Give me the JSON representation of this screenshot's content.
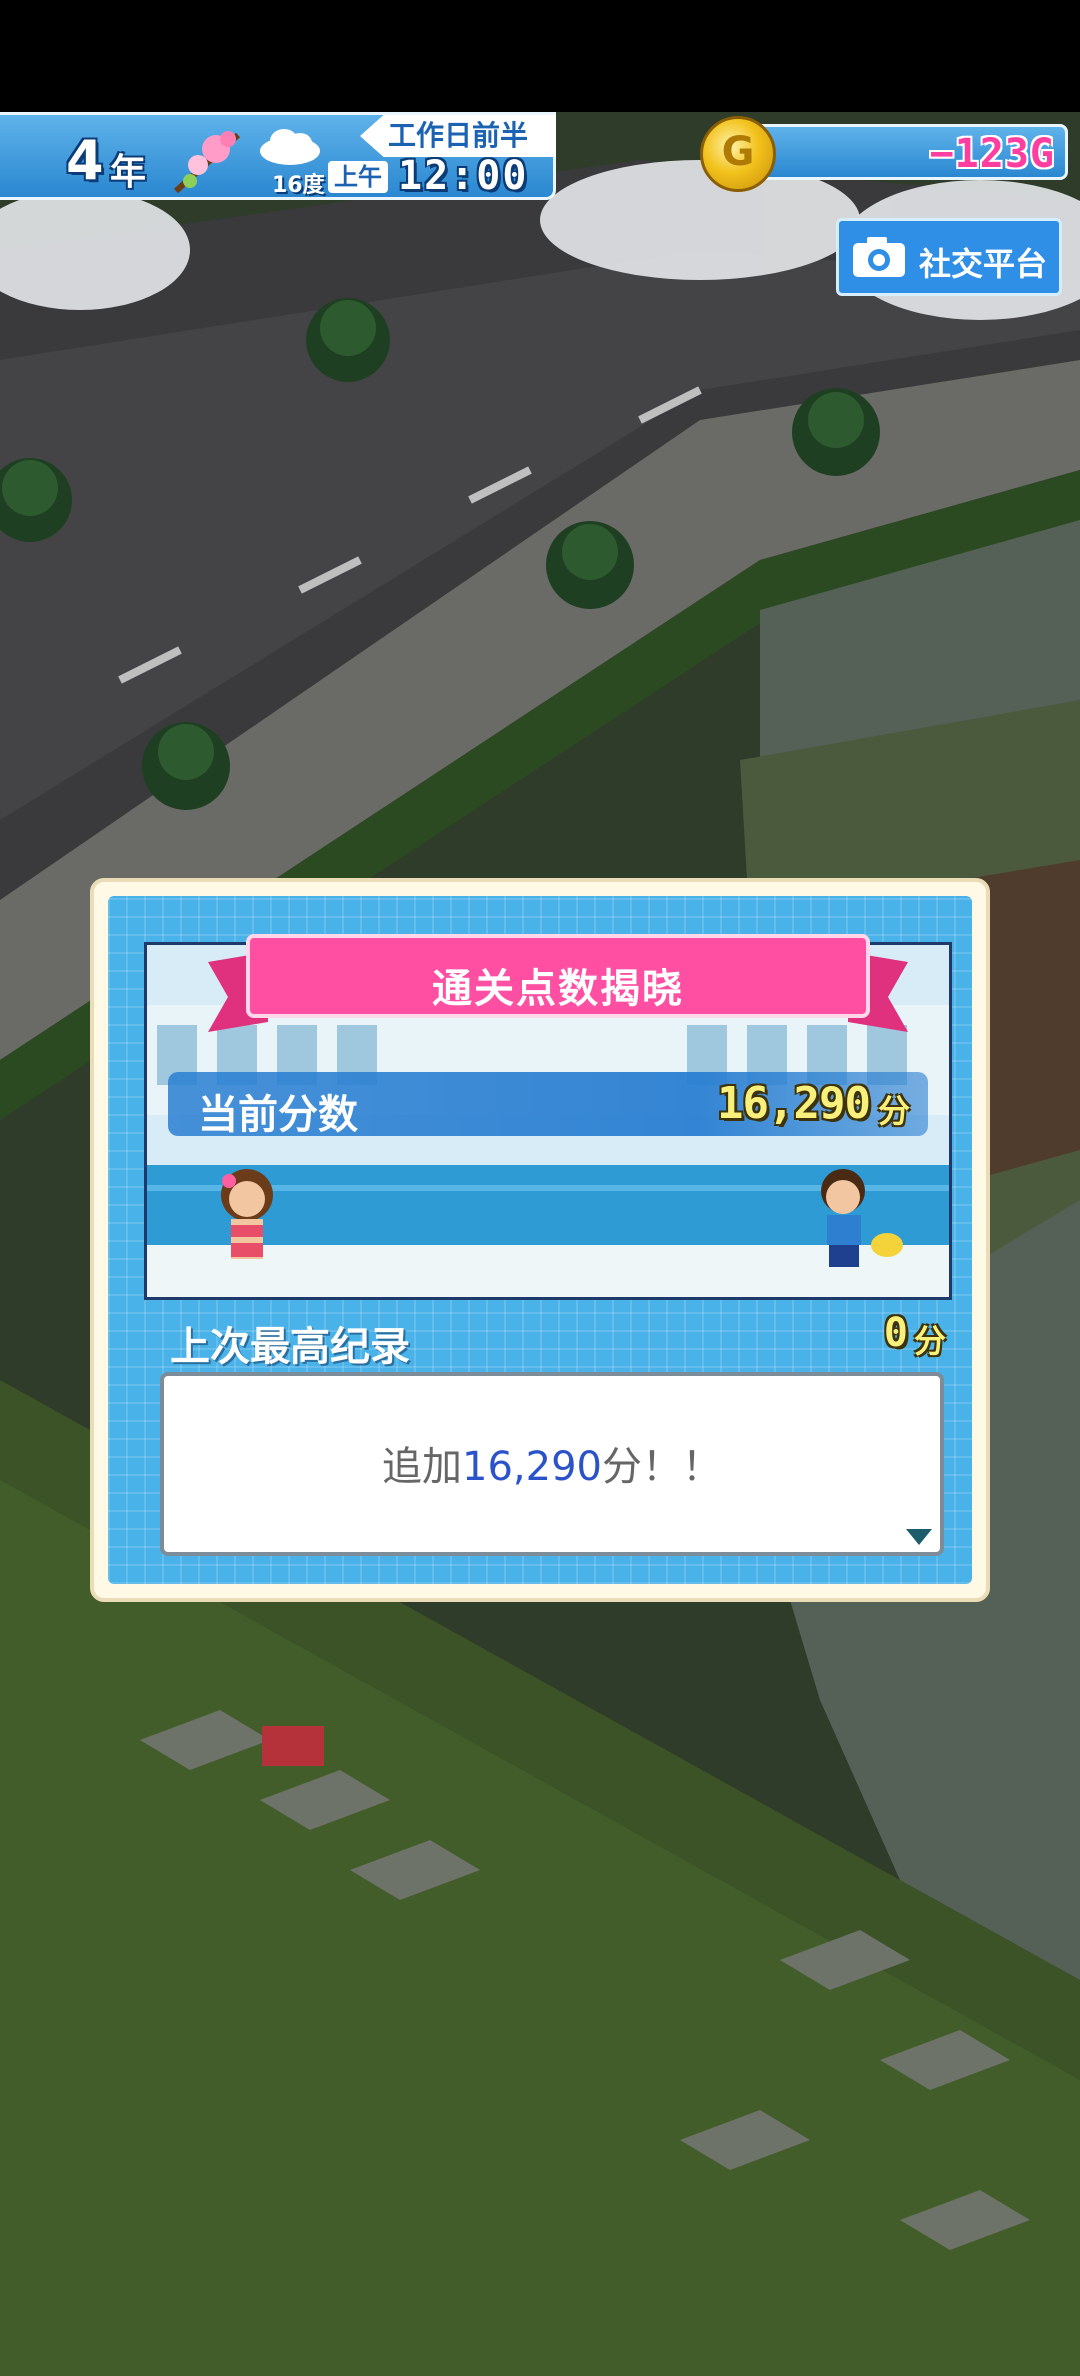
{
  "hud": {
    "year_number": "4",
    "year_unit": "年",
    "temperature": "16度",
    "phase": "工作日前半",
    "ampm": "上午",
    "time": "12:00",
    "money": "−123G"
  },
  "social_button": {
    "label": "社交平台"
  },
  "dialog": {
    "ribbon_title": "通关点数揭晓",
    "current_score_label": "当前分数",
    "current_score_value": "16,290",
    "current_score_unit": "分",
    "best_record_label": "上次最高纪录",
    "best_record_value": "0",
    "best_record_unit": "分",
    "message_prefix": "追加",
    "message_highlight": "16,290",
    "message_suffix": "分！！"
  },
  "icons": [
    "cherry-blossom-icon",
    "cloud-weather-icon",
    "coin-icon",
    "camera-icon",
    "continue-arrow-icon"
  ],
  "colors": {
    "hud_blue": "#2a87d0",
    "money_pink": "#ff3ea0",
    "ribbon_pink": "#ff4fa3",
    "score_yellow": "#f8f07a",
    "highlight_blue": "#2b53c9"
  }
}
